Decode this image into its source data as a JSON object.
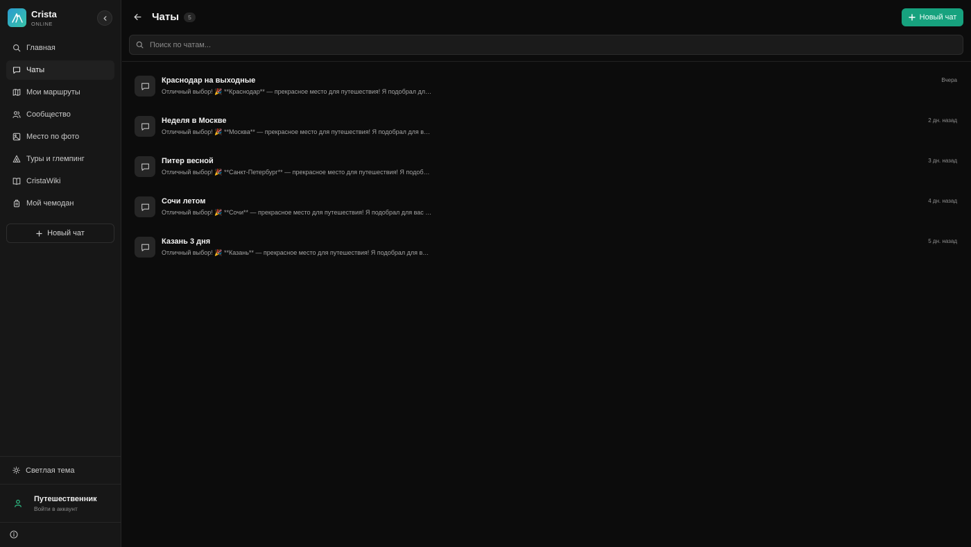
{
  "app": {
    "name": "Crista",
    "status": "ONLINE"
  },
  "sidebar": {
    "items": [
      {
        "label": "Главная",
        "icon": "search-icon"
      },
      {
        "label": "Чаты",
        "icon": "chat-icon",
        "active": true
      },
      {
        "label": "Мои маршруты",
        "icon": "map-icon"
      },
      {
        "label": "Сообщество",
        "icon": "users-icon"
      },
      {
        "label": "Место по фото",
        "icon": "image-search-icon"
      },
      {
        "label": "Туры и глемпинг",
        "icon": "tent-icon"
      },
      {
        "label": "CristaWiki",
        "icon": "book-icon"
      },
      {
        "label": "Мой чемодан",
        "icon": "luggage-icon"
      }
    ],
    "new_chat_label": "Новый чат",
    "theme_label": "Светлая тема",
    "user": {
      "name": "Путешественник",
      "subtitle": "Войти в аккаунт"
    }
  },
  "header": {
    "title": "Чаты",
    "count": "5",
    "new_chat_label": "Новый чат"
  },
  "search": {
    "placeholder": "Поиск по чатам...",
    "value": ""
  },
  "chats": [
    {
      "title": "Краснодар на выходные",
      "preview": "Отличный выбор! 🎉 **Краснодар** — прекрасное место для путешествия! Я подобрал для вас маршрут",
      "time": "Вчера"
    },
    {
      "title": "Неделя в Москве",
      "preview": "Отличный выбор! 🎉 **Москва** — прекрасное место для путешествия! Я подобрал для вас маршрут",
      "time": "2 дн. назад"
    },
    {
      "title": "Питер весной",
      "preview": "Отличный выбор! 🎉 **Санкт-Петербург** — прекрасное место для путешествия! Я подобрал для вас маршрут",
      "time": "3 дн. назад"
    },
    {
      "title": "Сочи летом",
      "preview": "Отличный выбор! 🎉 **Сочи** — прекрасное место для путешествия! Я подобрал для вас маршрут",
      "time": "4 дн. назад"
    },
    {
      "title": "Казань 3 дня",
      "preview": "Отличный выбор! 🎉 **Казань** — прекрасное место для путешествия! Я подобрал для вас маршрут",
      "time": "5 дн. назад"
    }
  ],
  "colors": {
    "accent": "#17a27e",
    "background": "#0c0c0c",
    "sidebar": "#171717",
    "user_icon": "#2fbf86"
  }
}
